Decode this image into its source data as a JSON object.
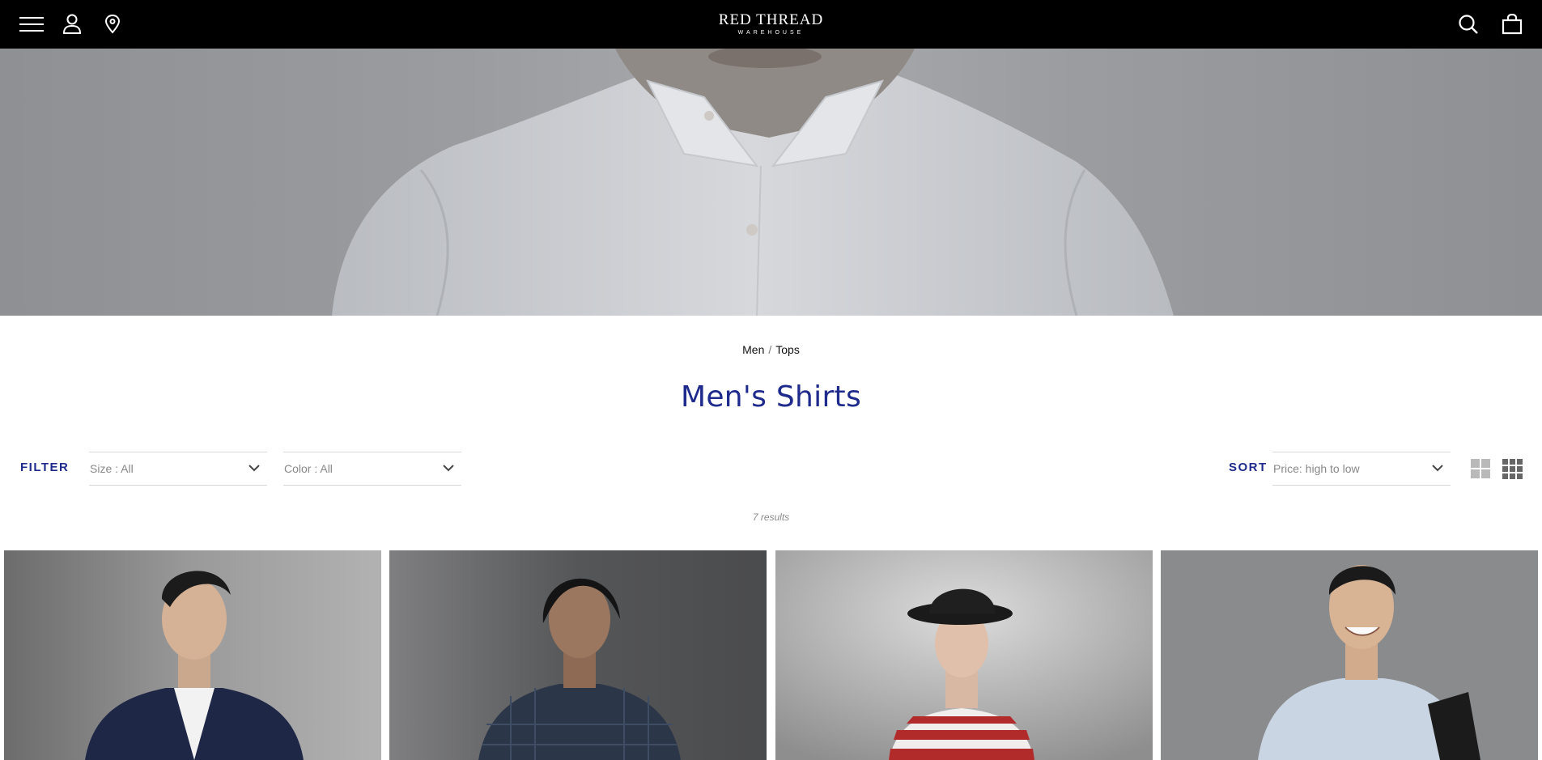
{
  "header": {
    "logo_main": "RED THREAD",
    "logo_sub": "WAREHOUSE",
    "left_icons": [
      "menu-icon",
      "account-icon",
      "location-pin-icon"
    ],
    "right_icons": [
      "search-icon",
      "shopping-bag-icon"
    ]
  },
  "breadcrumb": {
    "items": [
      "Men",
      "Tops"
    ],
    "separator": "/"
  },
  "page": {
    "title": "Men's Shirts"
  },
  "filters": {
    "label": "FILTER",
    "size": "Size : All",
    "color": "Color : All"
  },
  "sort": {
    "label": "SORT",
    "value": "Price: high to low"
  },
  "view_options": [
    "grid-2-icon",
    "grid-3-icon"
  ],
  "results_text": "7 results",
  "products": [
    {
      "image": "man in navy blazer and white shirt"
    },
    {
      "image": "man in dark plaid shirt"
    },
    {
      "image": "man in black hat and red striped tee"
    },
    {
      "image": "smiling man in light blue shirt with folder"
    }
  ],
  "colors": {
    "header_bg": "#000000",
    "accent": "#1e2a8c",
    "muted_text": "#888888"
  }
}
